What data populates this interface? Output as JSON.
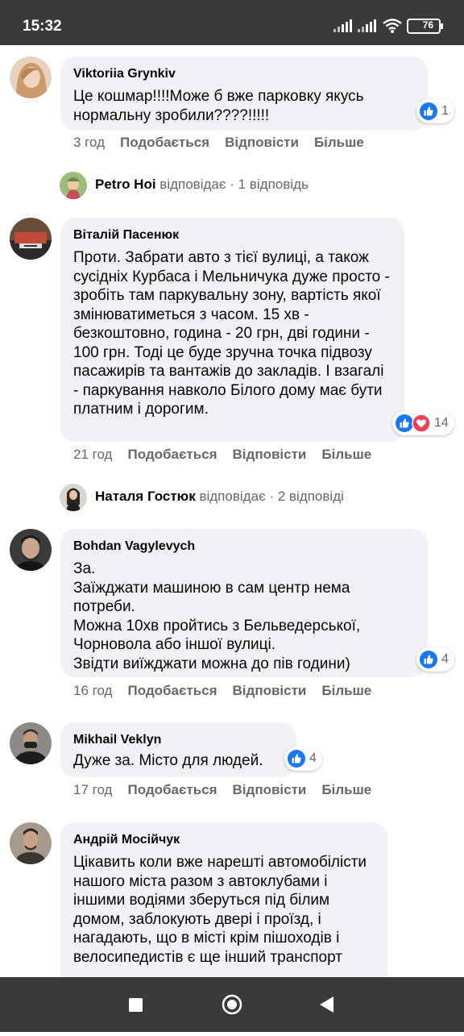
{
  "status_bar": {
    "time": "15:32",
    "battery": "76"
  },
  "comments": [
    {
      "author": "Viktoriia Grynkiv",
      "text": "Це кошмар!!!!Може б вже парковку якусь нормальну зробили????!!!!!",
      "reaction_count": "1",
      "time": "3 год",
      "like": "Подобається",
      "reply": "Відповісти",
      "more": "Більше",
      "replies": {
        "name": "Petro Hoi",
        "verb": "відповідає",
        "count": "· 1 відповідь"
      }
    },
    {
      "author": "Віталій Пасенюк",
      "text": "Проти. Забрати авто з тієї вулиці, а також сусідніх Курбаса і Мельничука дуже просто - зробіть там паркувальну зону, вартість якої змінюватиметься з часом. 15 хв - безкоштовно, година - 20 грн, дві години - 100 грн. Тоді це буде зручна точка підвозу пасажирів та вантажів до закладів. І взагалі - паркування навколо Білого дому має бути платним і дорогим.",
      "reaction_count": "14",
      "time": "21 год",
      "like": "Подобається",
      "reply": "Відповісти",
      "more": "Більше",
      "replies": {
        "name": "Наталя Гостюк",
        "verb": "відповідає",
        "count": "· 2 відповіді"
      }
    },
    {
      "author": "Bohdan Vagylevych",
      "lines": [
        "За.",
        "Заїжджати машиною в сам центр нема",
        "потреби.",
        "Можна 10хв пройтись з Бельведерської,",
        "Чорновола або іншої вулиці.",
        "Звідти виїжджати можна до пів години)"
      ],
      "reaction_count": "4",
      "time": "16 год",
      "like": "Подобається",
      "reply": "Відповісти",
      "more": "Більше"
    },
    {
      "author": "Mikhail Veklyn",
      "text": "Дуже за. Місто для людей.",
      "reaction_count": "4",
      "time": "17 год",
      "like": "Подобається",
      "reply": "Відповісти",
      "more": "Більше"
    },
    {
      "author": "Андрій Мосійчук",
      "text": "Цікавить коли вже нарешті автомобілісти нашого міста разом з автоклубами і іншими водіями зберуться під білим домом, заблокують двері і проїзд, і нагадають, що в місті крім пішоходів і велосипедистів є ще інший транспорт"
    }
  ],
  "colors": {
    "like_blue": "#1877f2",
    "love_red": "#f33e58",
    "bubble": "#f0f2f5",
    "meta_gray": "#65676b",
    "bar": "#3a3a3a"
  }
}
